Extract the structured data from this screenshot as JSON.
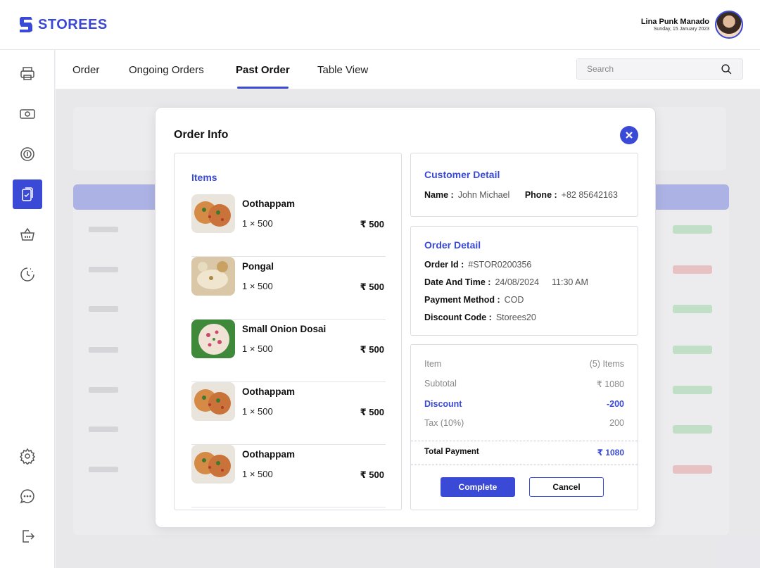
{
  "brand": {
    "name": "STOREES"
  },
  "user": {
    "name": "Lina Punk Manado",
    "date": "Sunday, 15 January 2023"
  },
  "sidebar": {
    "items": [
      {
        "icon": "printer-icon",
        "active": false
      },
      {
        "icon": "cash-icon",
        "active": false
      },
      {
        "icon": "coin-cycle-icon",
        "active": false
      },
      {
        "icon": "clipboard-check-icon",
        "active": true
      },
      {
        "icon": "basket-icon",
        "active": false
      },
      {
        "icon": "timer-icon",
        "active": false
      }
    ],
    "bottom": [
      {
        "icon": "gear-icon"
      },
      {
        "icon": "chat-icon"
      },
      {
        "icon": "logout-icon"
      }
    ]
  },
  "tabs": [
    {
      "label": "Order"
    },
    {
      "label": "Ongoing Orders"
    },
    {
      "label": "Past Order",
      "active": true
    },
    {
      "label": "Table View"
    }
  ],
  "search": {
    "placeholder": "Search"
  },
  "modal": {
    "title": "Order Info",
    "items_title": "Items",
    "items": [
      {
        "name": "Oothappam",
        "qty": "1 × 500",
        "price": "₹ 500"
      },
      {
        "name": "Pongal",
        "qty": "1 × 500",
        "price": "₹ 500"
      },
      {
        "name": "Small Onion Dosai",
        "qty": "1 × 500",
        "price": "₹ 500"
      },
      {
        "name": "Oothappam",
        "qty": "1 × 500",
        "price": "₹ 500"
      },
      {
        "name": "Oothappam",
        "qty": "1 × 500",
        "price": "₹ 500"
      }
    ],
    "customer": {
      "title": "Customer Detail",
      "name_label": "Name :",
      "name": "John Michael",
      "phone_label": "Phone :",
      "phone": "+82 85642163"
    },
    "order": {
      "title": "Order Detail",
      "id_label": "Order Id :",
      "id": "#STOR0200356",
      "datetime_label": "Date And Time :",
      "date": "24/08/2024",
      "time": "11:30 AM",
      "payment_label": "Payment Method :",
      "payment": "COD",
      "discount_label": "Discount Code :",
      "discount_code": "Storees20"
    },
    "summary": {
      "item_label": "Item",
      "item_value": "(5) Items",
      "subtotal_label": "Subtotal",
      "subtotal_value": "₹ 1080",
      "discount_label": "Discount",
      "discount_value": "-200",
      "tax_label": "Tax (10%)",
      "tax_value": "200",
      "total_label": "Total Payment",
      "total_value": "₹ 1080"
    },
    "complete_label": "Complete",
    "cancel_label": "Cancel"
  },
  "colors": {
    "accent": "#3a4ad6",
    "success": "#b9e6bf",
    "danger": "#f4b9b9"
  }
}
